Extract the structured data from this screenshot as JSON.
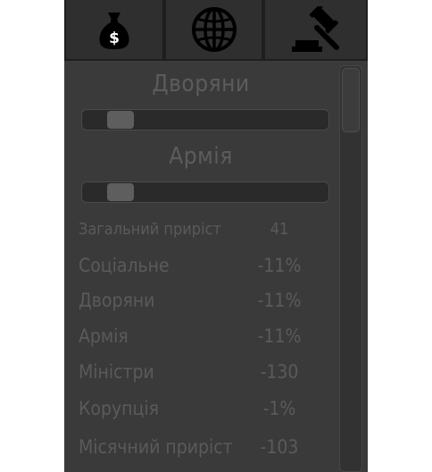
{
  "tabs": [
    {
      "icon": "money-bag-icon"
    },
    {
      "icon": "globe-icon"
    },
    {
      "icon": "gavel-icon"
    }
  ],
  "sliders": [
    {
      "label": "Дворяни",
      "value_fraction": 0.13
    },
    {
      "label": "Армія",
      "value_fraction": 0.13
    }
  ],
  "stats": [
    {
      "label": "Загальний приріст",
      "value": "41"
    },
    {
      "label": "Соціальне",
      "value": "-11%"
    },
    {
      "label": "Дворяни",
      "value": "-11%"
    },
    {
      "label": "Армія",
      "value": "-11%"
    },
    {
      "label": "Міністри",
      "value": "-130"
    },
    {
      "label": "Корупція",
      "value": "-1%"
    },
    {
      "label": "Місячний приріст",
      "value": "-103"
    }
  ],
  "colors": {
    "panel_bg": "#3a3a3a",
    "text": "#5a5a5a",
    "tab_bg": "#2f2f2f"
  }
}
